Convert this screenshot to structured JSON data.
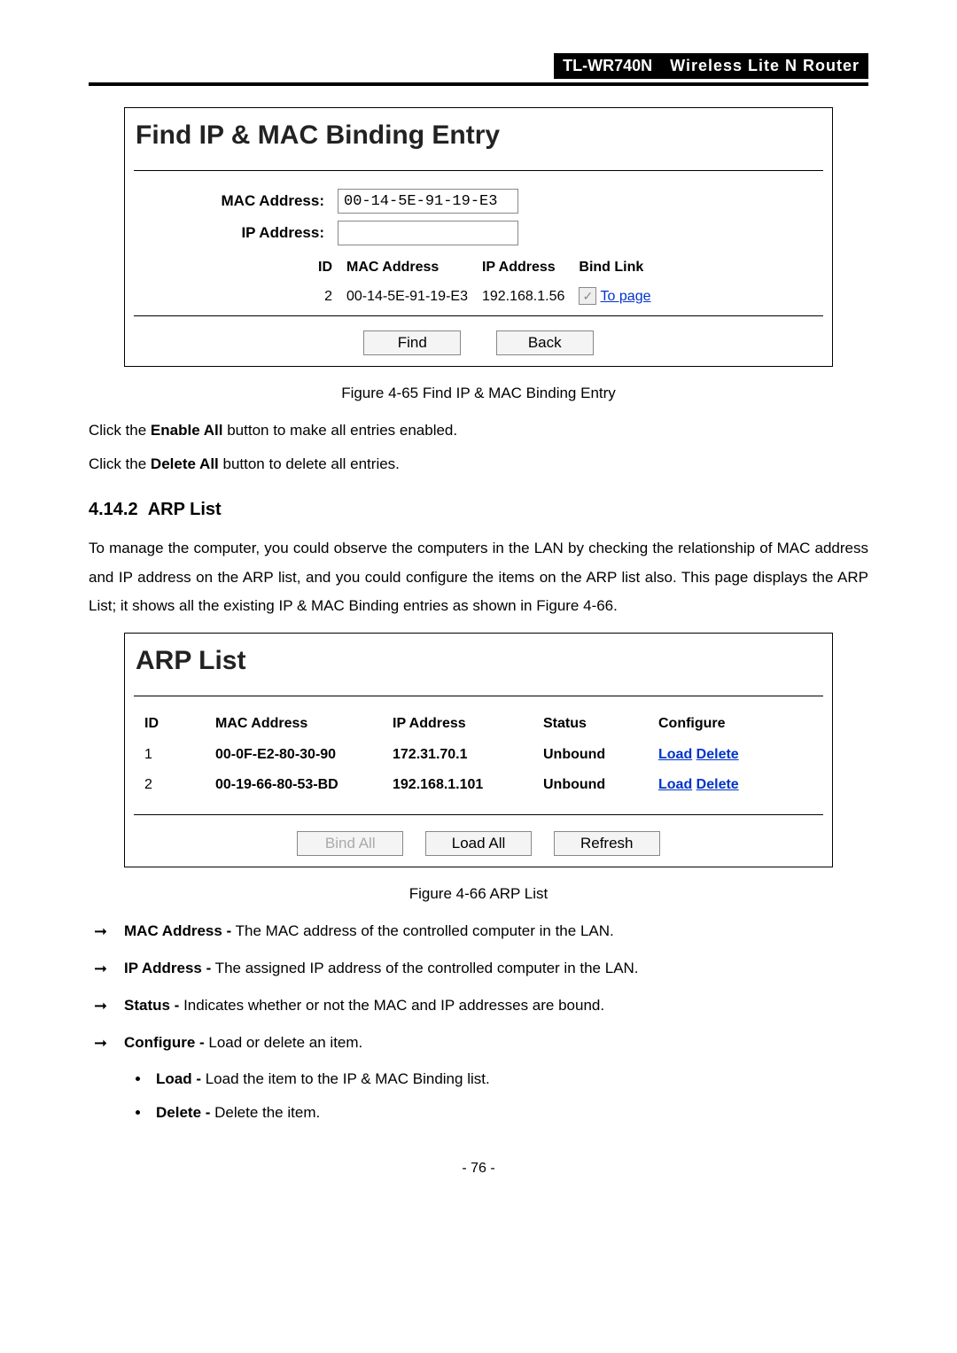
{
  "header": {
    "model": "TL-WR740N",
    "desc": "Wireless  Lite  N  Router"
  },
  "panel1": {
    "title": "Find IP & MAC Binding Entry",
    "labels": {
      "mac": "MAC Address:",
      "ip": "IP Address:",
      "id": "ID"
    },
    "inputs": {
      "mac_value": "00-14-5E-91-19-E3",
      "ip_value": ""
    },
    "cols": {
      "mac": "MAC Address",
      "ip": "IP Address",
      "bind": "Bind Link"
    },
    "row": {
      "id": "2",
      "mac": "00-14-5E-91-19-E3",
      "ip": "192.168.1.56",
      "link": "To page"
    },
    "buttons": {
      "find": "Find",
      "back": "Back"
    },
    "caption": "Figure 4-65 Find IP & MAC Binding Entry"
  },
  "text1": {
    "pre": "Click the ",
    "bold": "Enable All",
    "post": " button to make all entries enabled."
  },
  "text2": {
    "pre": "Click the ",
    "bold": "Delete All",
    "post": " button to delete all entries."
  },
  "section": {
    "num": "4.14.2",
    "title": "ARP List"
  },
  "arp_intro": "To manage the computer, you could observe the computers in the LAN by checking the relationship of MAC address and IP address on the ARP list, and you could configure the items on the ARP list also. This page displays the ARP List; it shows all the existing IP & MAC Binding entries as shown in Figure 4-66.",
  "panel2": {
    "title": "ARP List",
    "cols": {
      "id": "ID",
      "mac": "MAC Address",
      "ip": "IP Address",
      "status": "Status",
      "conf": "Configure"
    },
    "rows": [
      {
        "id": "1",
        "mac": "00-0F-E2-80-30-90",
        "ip": "172.31.70.1",
        "status": "Unbound",
        "load": "Load",
        "delete": "Delete"
      },
      {
        "id": "2",
        "mac": "00-19-66-80-53-BD",
        "ip": "192.168.1.101",
        "status": "Unbound",
        "load": "Load",
        "delete": "Delete"
      }
    ],
    "buttons": {
      "bind_all": "Bind All",
      "load_all": "Load All",
      "refresh": "Refresh"
    },
    "caption": "Figure 4-66    ARP List"
  },
  "defs": [
    {
      "term": "MAC Address -",
      "desc": " The MAC address of the controlled computer in the LAN."
    },
    {
      "term": "IP Address -",
      "desc": " The assigned IP address of the controlled computer in the LAN."
    },
    {
      "term": "Status -",
      "desc": " Indicates whether or not the MAC and IP addresses are bound."
    },
    {
      "term": "Configure -",
      "desc": " Load or delete an item."
    }
  ],
  "sub_defs": [
    {
      "term": "Load -",
      "desc": " Load the item to the IP & MAC Binding list."
    },
    {
      "term": "Delete -",
      "desc": " Delete the item."
    }
  ],
  "page_num": "- 76 -"
}
